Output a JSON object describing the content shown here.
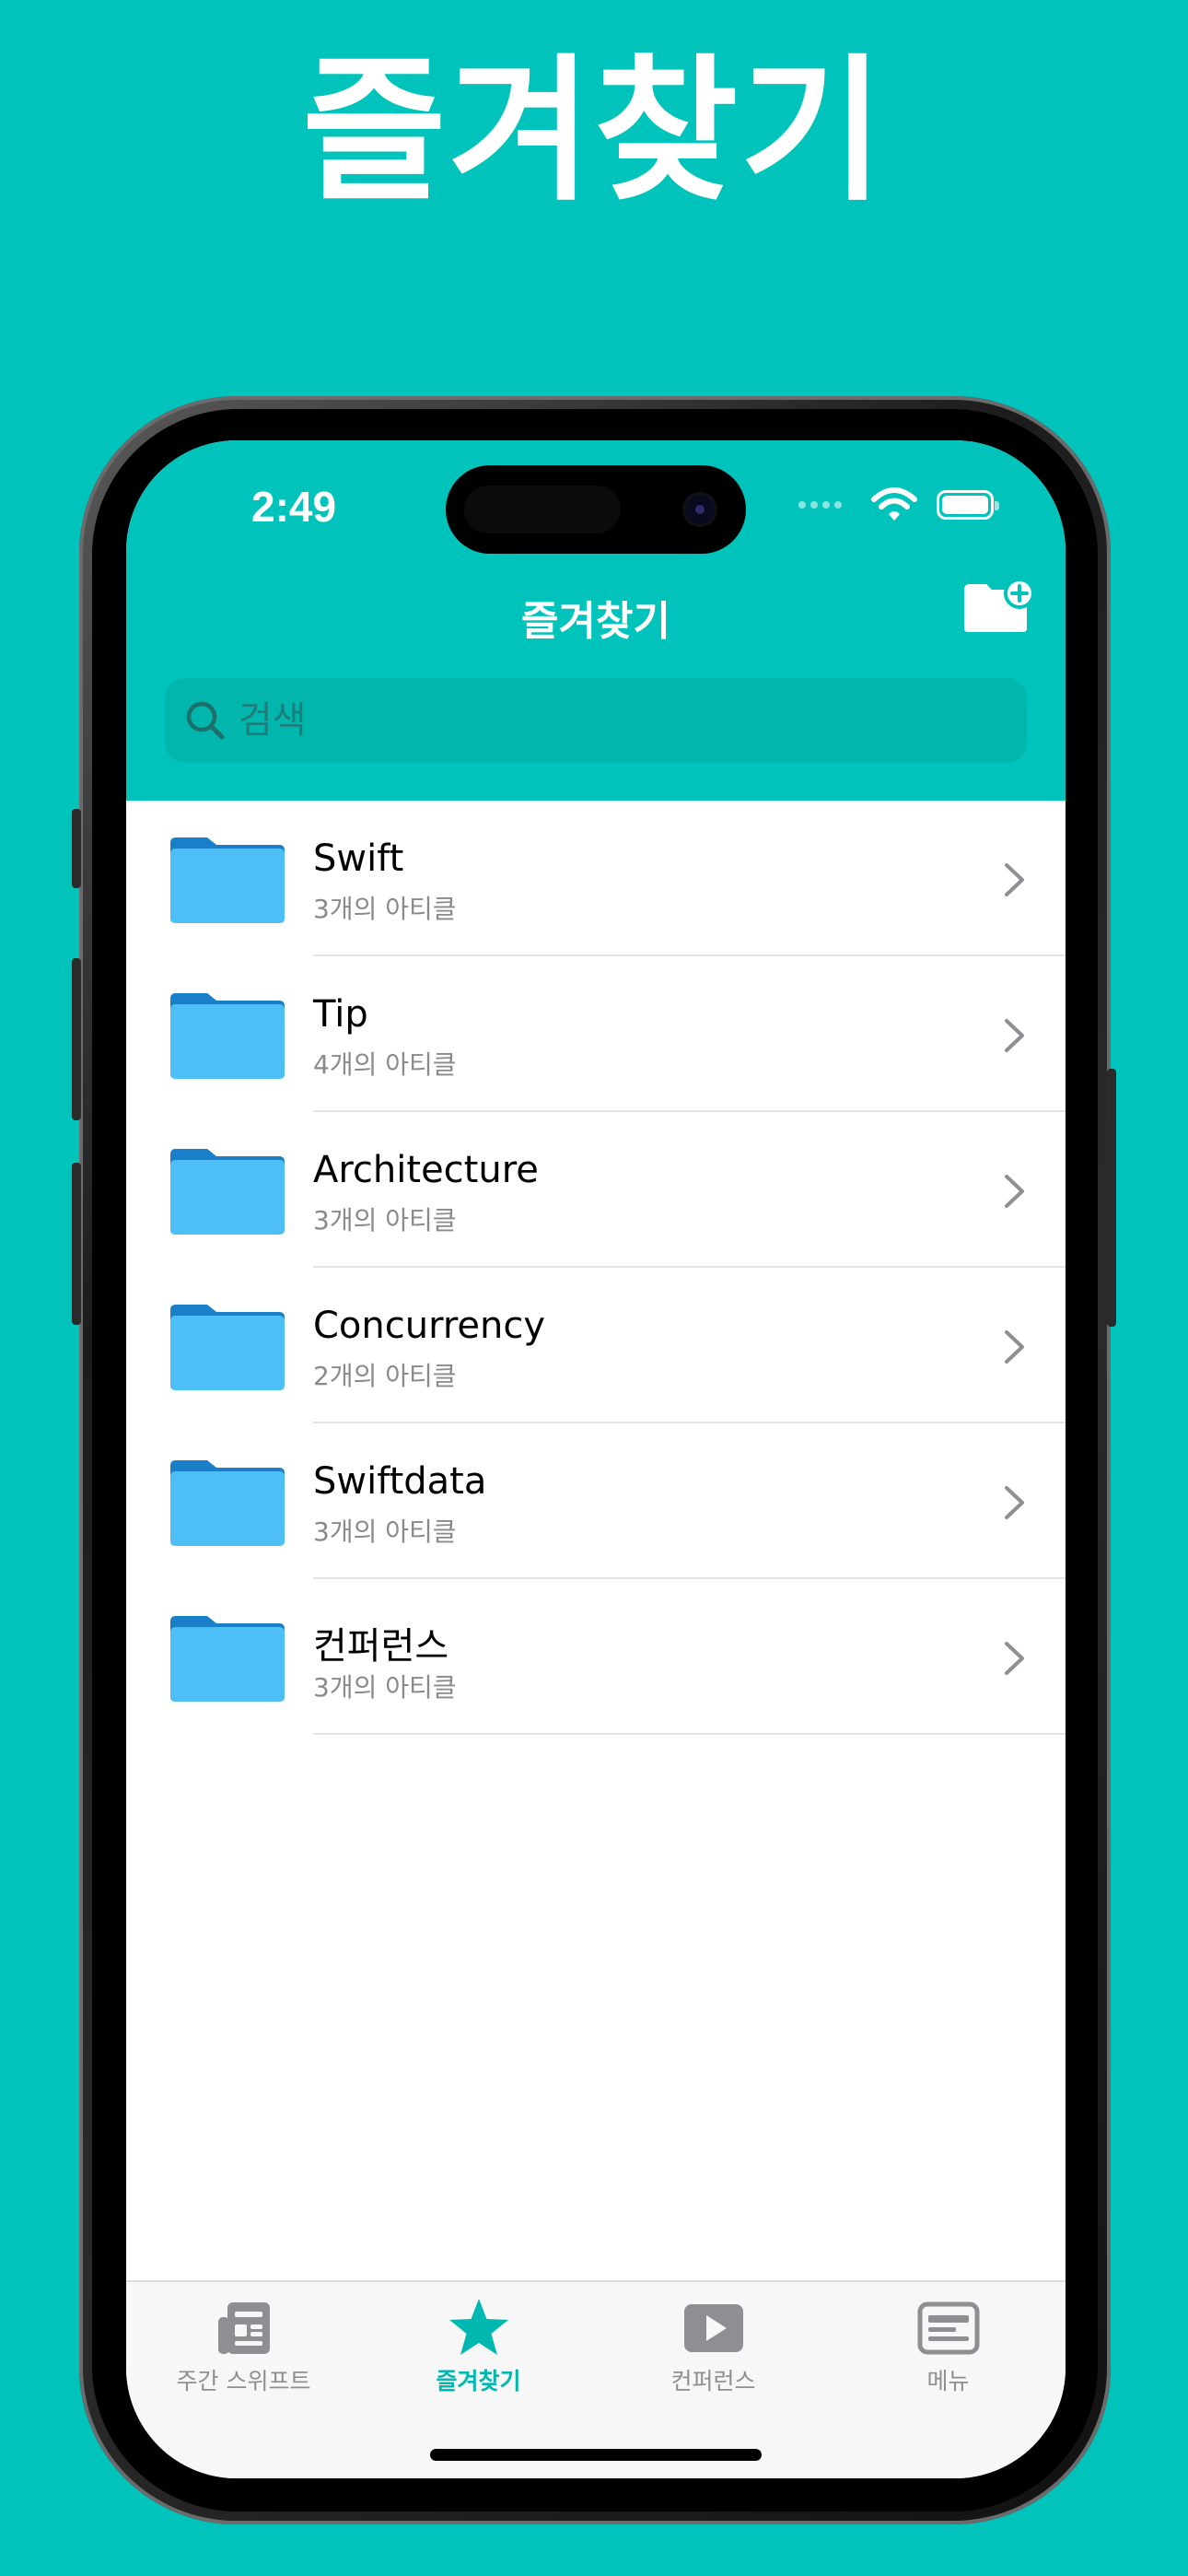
{
  "promo": {
    "title": "즐겨찾기"
  },
  "status_bar": {
    "time": "2:49"
  },
  "nav": {
    "title": "즐겨찾기",
    "add_folder_icon": "folder-plus-icon"
  },
  "search": {
    "placeholder": "검색",
    "value": ""
  },
  "folders": [
    {
      "name": "Swift",
      "count": "3개의 아티클"
    },
    {
      "name": "Tip",
      "count": "4개의 아티클"
    },
    {
      "name": "Architecture",
      "count": "3개의 아티클"
    },
    {
      "name": "Concurrency",
      "count": "2개의 아티클"
    },
    {
      "name": "Swiftdata",
      "count": "3개의 아티클"
    },
    {
      "name": "컨퍼런스",
      "count": "3개의 아티클"
    }
  ],
  "tabs": [
    {
      "label": "주간 스위프트",
      "icon": "newspaper-icon",
      "active": false
    },
    {
      "label": "즐겨찾기",
      "icon": "star-icon",
      "active": true
    },
    {
      "label": "컨퍼런스",
      "icon": "play-icon",
      "active": false
    },
    {
      "label": "메뉴",
      "icon": "menu-card-icon",
      "active": false
    }
  ],
  "colors": {
    "accent": "#00C4BB",
    "folder_light": "#4DBEF6",
    "folder_dark": "#1A7FC9",
    "tab_inactive": "#8E8E93"
  }
}
